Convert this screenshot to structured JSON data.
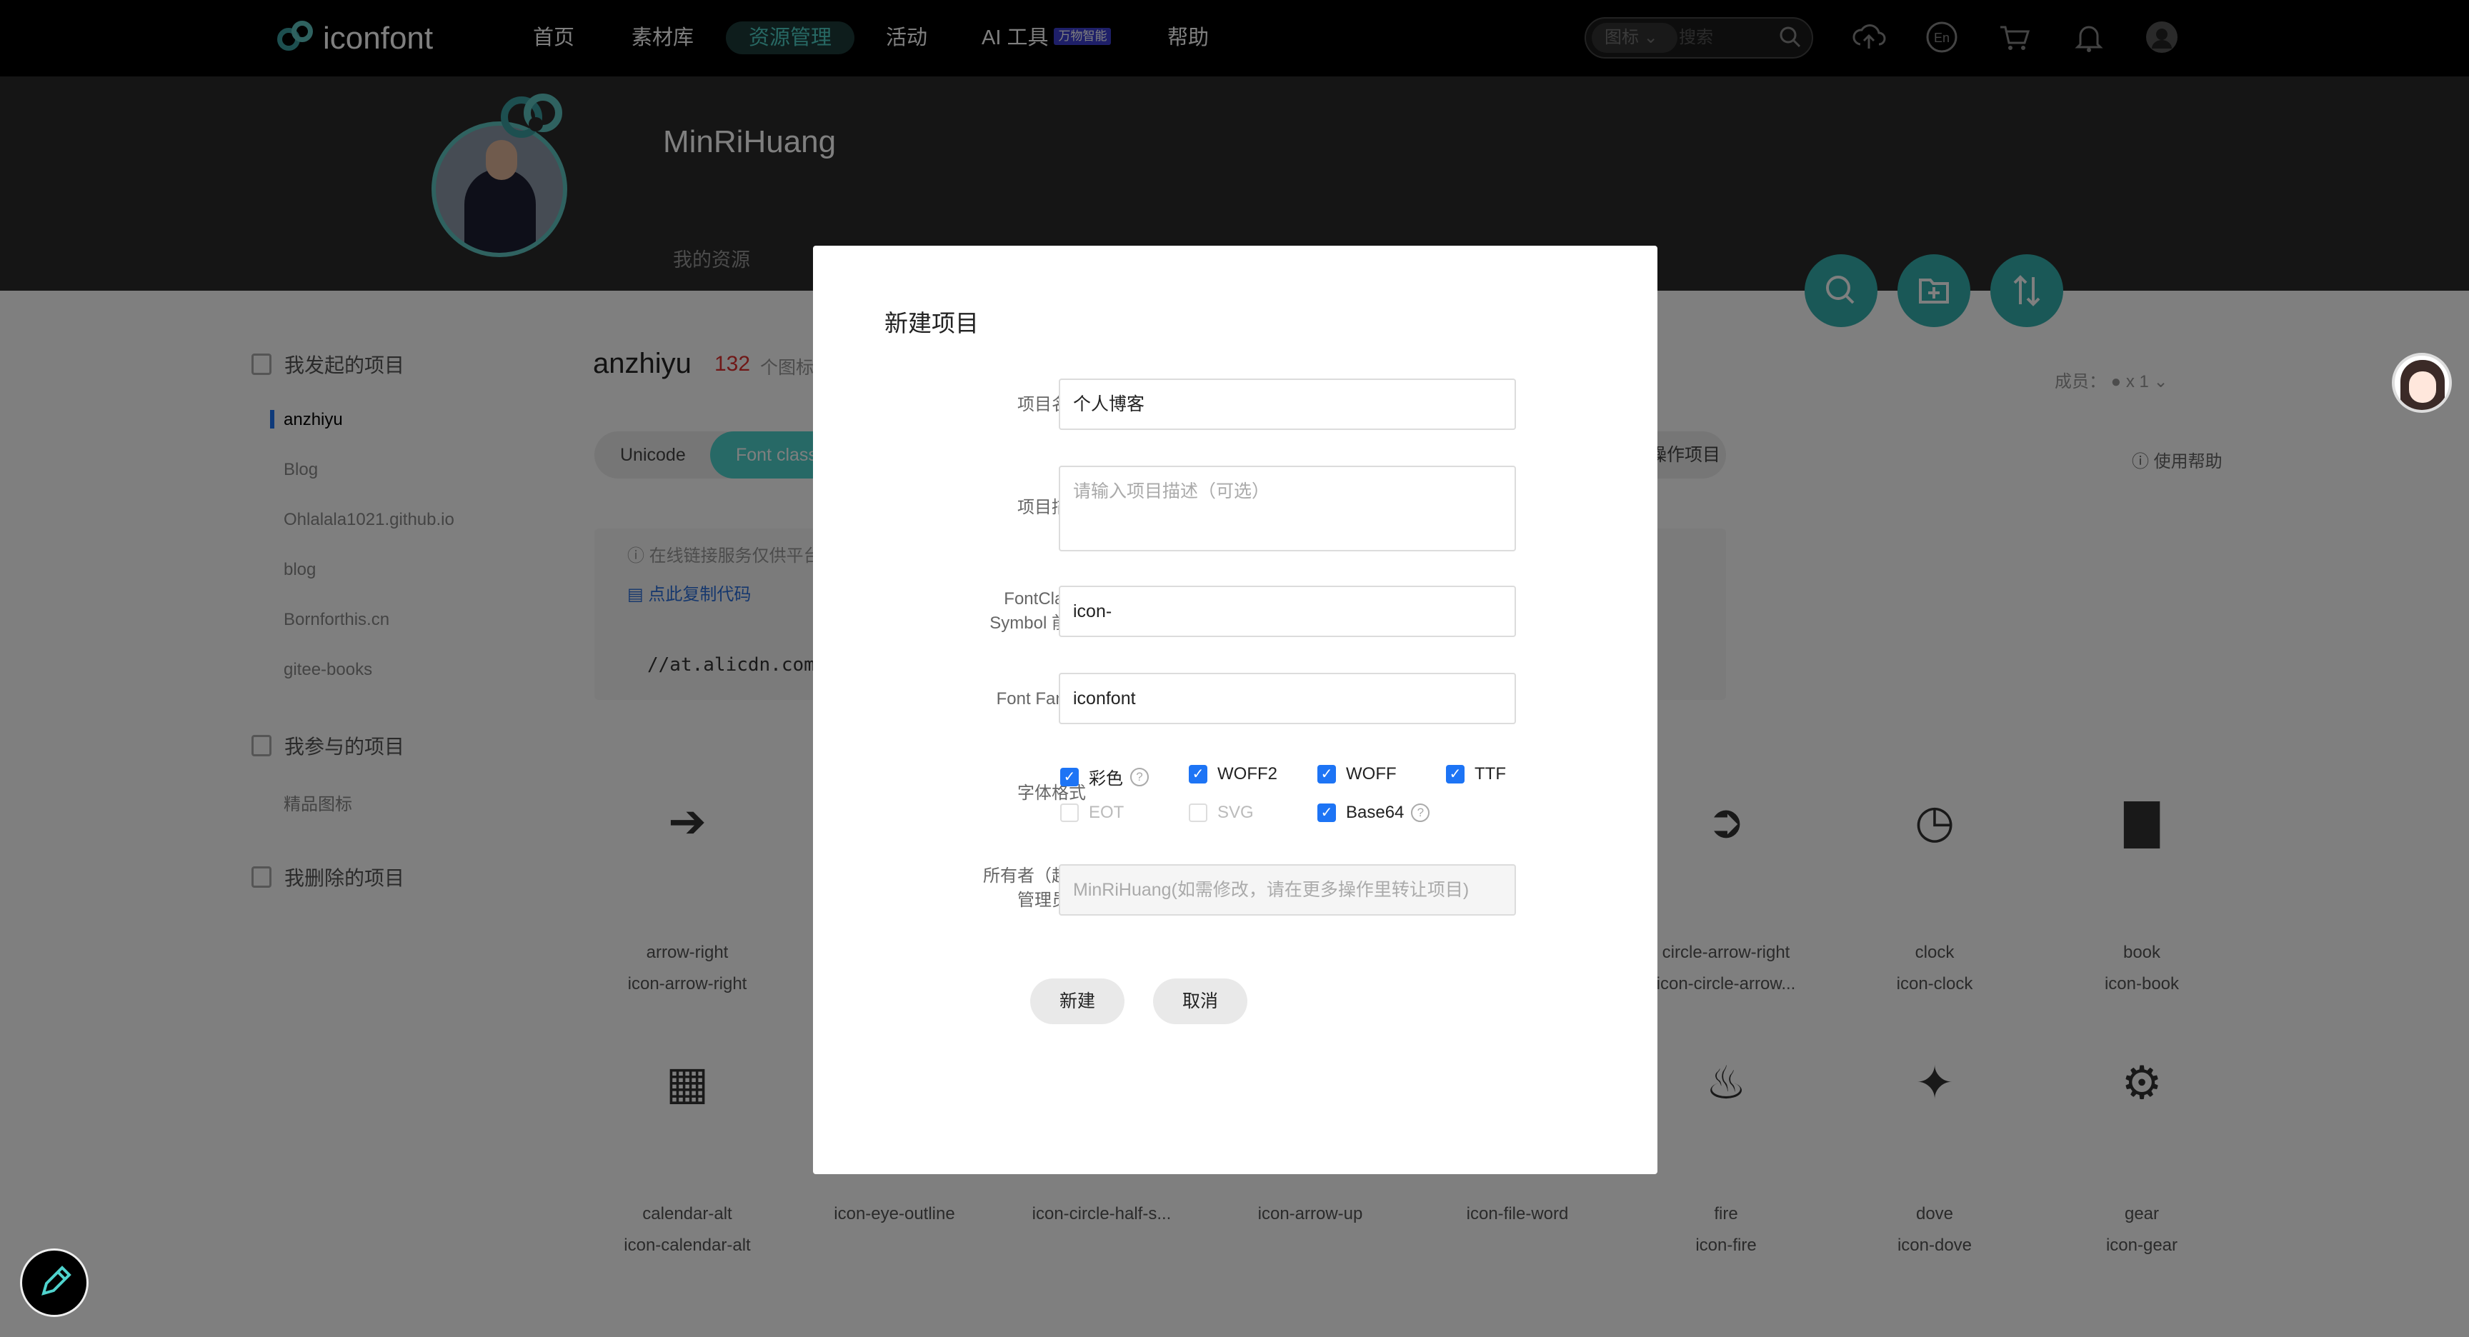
{
  "nav": {
    "logo_text": "iconfont",
    "items": [
      "首页",
      "素材库",
      "资源管理",
      "活动",
      "AI 工具",
      "帮助"
    ],
    "ai_badge": "万物智能",
    "search_type": "图标",
    "search_placeholder": "搜索"
  },
  "profile": {
    "username": "MinRiHuang",
    "tab": "我的资源"
  },
  "sidebar": {
    "section1": "我发起的项目",
    "projects": [
      "anzhiyu",
      "Blog",
      "Ohlalala1021.github.io",
      "blog",
      "Bornforthis.cn",
      "gitee-books"
    ],
    "section2": "我参与的项目",
    "joined": [
      "精品图标"
    ],
    "section3": "我删除的项目"
  },
  "project": {
    "name": "anzhiyu",
    "count": "132",
    "count_unit": "个图标",
    "tabs": [
      "Unicode",
      "Font class"
    ],
    "tab_right": "更多操作项目",
    "note": "在线链接服务仅供平台体验和调试使用",
    "copy": "点此复制代码",
    "url": "//at.alicdn.com/",
    "members": "成员：",
    "members_count": "x 1",
    "help": "使用帮助"
  },
  "icons_row1": [
    {
      "name": "arrow-right",
      "class": "icon-arrow-right",
      "glyph": "➔"
    },
    {
      "name": "circle-arrow-right",
      "class": "icon-circle-arrow...",
      "glyph": "➲"
    },
    {
      "name": "clock",
      "class": "icon-clock",
      "glyph": "◷"
    },
    {
      "name": "book",
      "class": "icon-book",
      "glyph": "▇"
    }
  ],
  "icons_row2": [
    {
      "name": "calendar-alt",
      "class": "icon-calendar-alt",
      "glyph": "▦"
    },
    {
      "name": "",
      "class": "icon-eye-outline",
      "glyph": ""
    },
    {
      "name": "",
      "class": "icon-circle-half-s...",
      "glyph": ""
    },
    {
      "name": "",
      "class": "icon-arrow-up",
      "glyph": ""
    },
    {
      "name": "",
      "class": "icon-file-word",
      "glyph": ""
    },
    {
      "name": "fire",
      "class": "icon-fire",
      "glyph": "♨"
    },
    {
      "name": "dove",
      "class": "icon-dove",
      "glyph": "✦"
    },
    {
      "name": "gear",
      "class": "icon-gear",
      "glyph": "⚙"
    }
  ],
  "modal": {
    "title": "新建项目",
    "label_name": "项目名称",
    "value_name": "个人博客",
    "label_desc": "项目描述",
    "placeholder_desc": "请输入项目描述（可选）",
    "label_prefix_1": "FontClass/",
    "label_prefix_2": "Symbol 前缀",
    "value_prefix": "icon-",
    "label_family": "Font Family",
    "value_family": "iconfont",
    "label_format": "字体格式",
    "formats": [
      {
        "label": "彩色",
        "checked": true
      },
      {
        "label": "WOFF2",
        "checked": true
      },
      {
        "label": "WOFF",
        "checked": true
      },
      {
        "label": "TTF",
        "checked": true
      },
      {
        "label": "EOT",
        "checked": false
      },
      {
        "label": "SVG",
        "checked": false
      },
      {
        "label": "Base64",
        "checked": true
      }
    ],
    "label_owner_1": "所有者（超级",
    "label_owner_2": "管理员）",
    "placeholder_owner": "MinRiHuang(如需修改，请在更多操作里转让项目)",
    "btn_create": "新建",
    "btn_cancel": "取消"
  }
}
